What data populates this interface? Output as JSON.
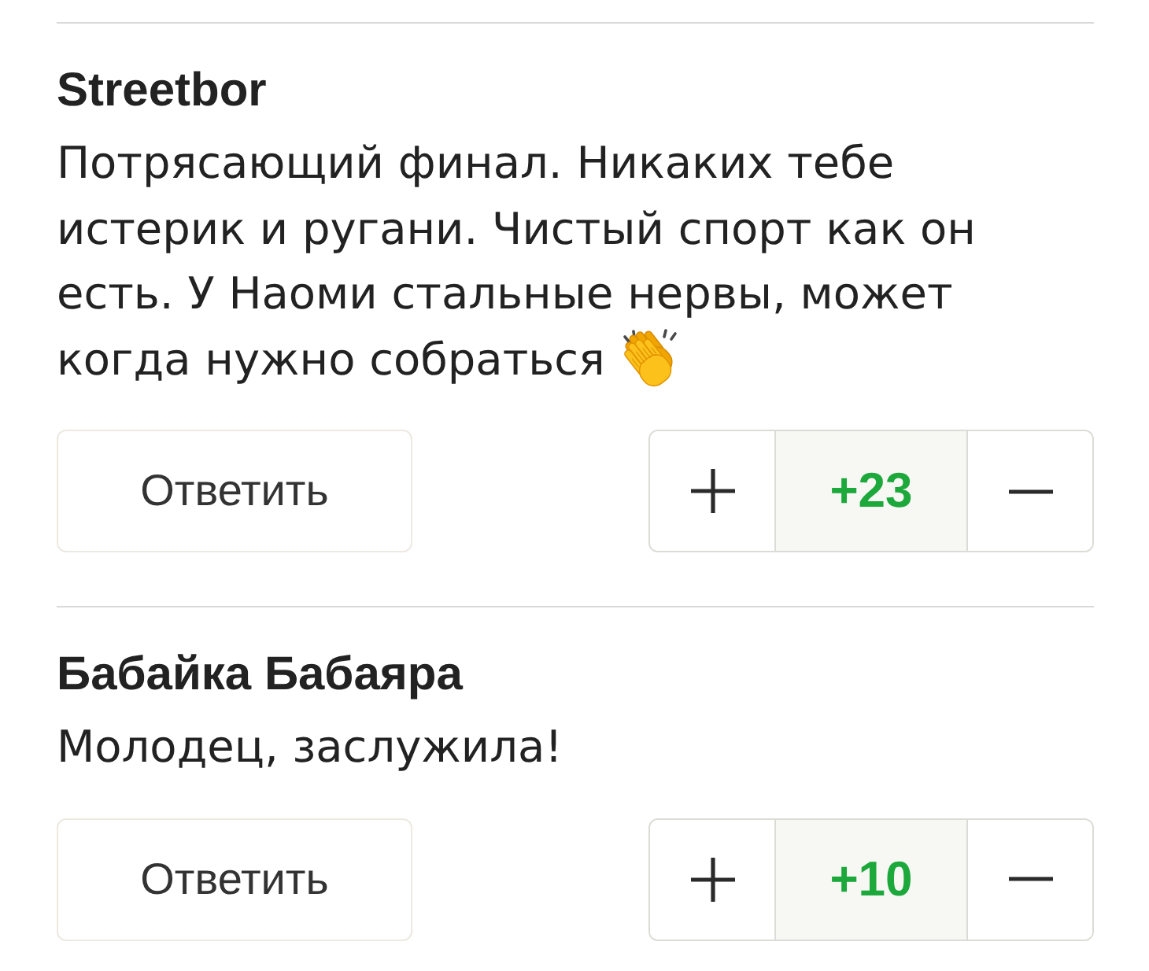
{
  "comments": [
    {
      "author": "Streetbor",
      "text": "Потрясающий финал. Никаких тебе истерик и ругани. Чистый спорт как он есть. У Наоми стальные нервы, может когда нужно собраться",
      "trailing_emoji": true,
      "reply_label": "Ответить",
      "score": "+23"
    },
    {
      "author": "Бабайка Бабаяра",
      "text": "Молодец, заслужила!",
      "trailing_emoji": false,
      "reply_label": "Ответить",
      "score": "+10"
    }
  ]
}
